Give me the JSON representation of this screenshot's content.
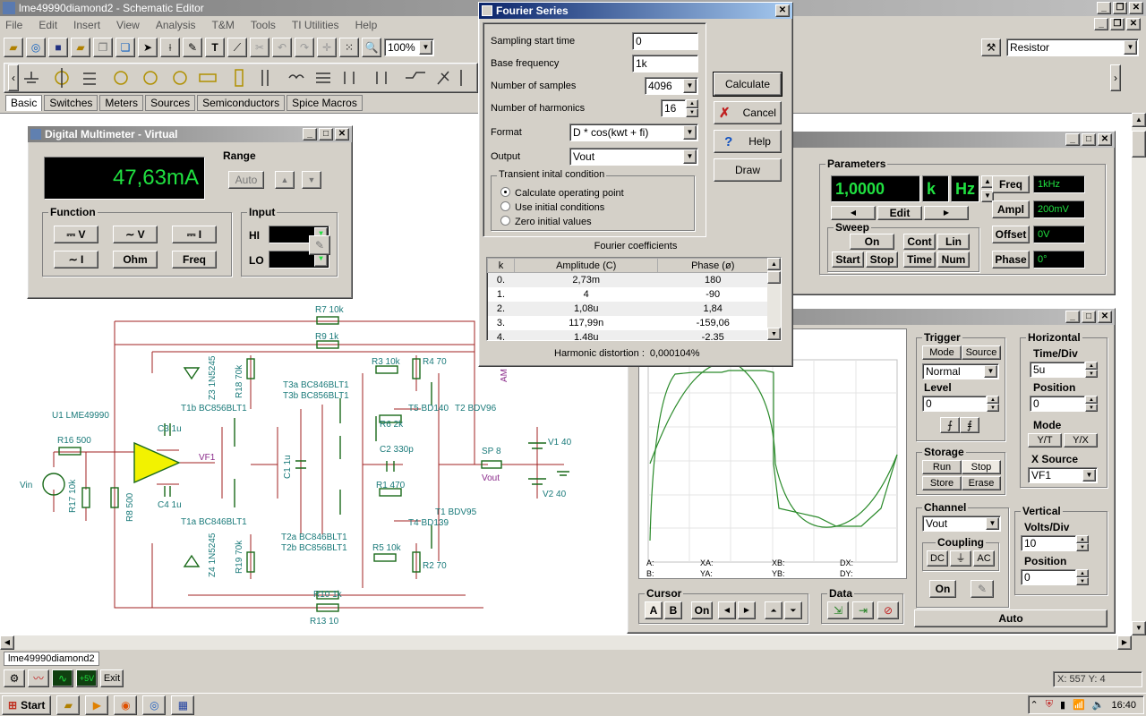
{
  "app": {
    "title": "lme49990diamond2 - Schematic Editor",
    "menu": [
      "File",
      "Edit",
      "Insert",
      "View",
      "Analysis",
      "T&M",
      "Tools",
      "TI Utilities",
      "Help"
    ],
    "zoom": "100%",
    "component_select": "Resistor",
    "tabs": [
      "Basic",
      "Switches",
      "Meters",
      "Sources",
      "Semiconductors",
      "Spice Macros"
    ],
    "doc_tab": "lme49990diamond2",
    "status_coords": "X: 557 Y: 4",
    "exit_label": "Exit"
  },
  "multimeter": {
    "title": "Digital Multimeter - Virtual",
    "display": "47,63mA",
    "range_label": "Range",
    "auto": "Auto",
    "function_label": "Function",
    "input_label": "Input",
    "buttons": [
      "⎓ V",
      "∼ V",
      "⎓ I",
      "∼ I",
      "Ohm",
      "Freq"
    ],
    "hi": "HI",
    "lo": "LO"
  },
  "fourier": {
    "title": "Fourier Series",
    "rows": [
      {
        "label": "Sampling start time",
        "value": "0"
      },
      {
        "label": "Base frequency",
        "value": "1k"
      },
      {
        "label": "Number of samples",
        "value": "4096"
      },
      {
        "label": "Number of harmonics",
        "value": "16"
      },
      {
        "label": "Format",
        "value": "D * cos(kwt + fi)"
      },
      {
        "label": "Output",
        "value": "Vout"
      }
    ],
    "transient_label": "Transient inital condition",
    "radios": [
      "Calculate operating point",
      "Use initial conditions",
      "Zero initial values"
    ],
    "buttons": {
      "calculate": "Calculate",
      "cancel": "Cancel",
      "help": "Help",
      "draw": "Draw"
    },
    "coeff_title": "Fourier coefficients",
    "headers": [
      "k",
      "Amplitude (C)",
      "Phase (ø)"
    ],
    "coeffs": [
      [
        "0.",
        "2,73m",
        "180"
      ],
      [
        "1.",
        "4",
        "-90"
      ],
      [
        "2.",
        "1,08u",
        "1,84"
      ],
      [
        "3.",
        "117,99n",
        "-159,06"
      ],
      [
        "4.",
        "1.48u",
        "-2.35"
      ]
    ],
    "thd_label": "Harmonic distortion :",
    "thd_value": "0,000104%"
  },
  "generator": {
    "params_label": "Parameters",
    "value": "1,0000",
    "prefix": "k",
    "unit": "Hz",
    "edit": "Edit",
    "sweep_label": "Sweep",
    "sweep_buttons": [
      "On",
      "Cont",
      "Lin",
      "Start",
      "Stop",
      "Time",
      "Num"
    ],
    "fields": [
      {
        "label": "Freq",
        "value": "1kHz"
      },
      {
        "label": "Ampl",
        "value": "200mV"
      },
      {
        "label": "Offset",
        "value": "0V"
      },
      {
        "label": "Phase",
        "value": "0°"
      }
    ]
  },
  "scope": {
    "trigger_label": "Trigger",
    "mode": "Mode",
    "source": "Source",
    "trigger_mode": "Normal",
    "level_label": "Level",
    "level": "0",
    "horizontal_label": "Horizontal",
    "timediv_label": "Time/Div",
    "timediv": "5u",
    "hpos_label": "Position",
    "hpos": "0",
    "hmode_label": "Mode",
    "yt": "Y/T",
    "yx": "Y/X",
    "xsource_label": "X Source",
    "xsource": "VF1",
    "storage_label": "Storage",
    "storage_buttons": [
      "Run",
      "Stop",
      "Store",
      "Erase"
    ],
    "channel_label": "Channel",
    "channel": "Vout",
    "coupling_label": "Coupling",
    "coupling": [
      "DC",
      "⏚",
      "AC"
    ],
    "ch_on": "On",
    "vertical_label": "Vertical",
    "voltsdiv_label": "Volts/Div",
    "voltsdiv": "10",
    "vpos_label": "Position",
    "vpos": "0",
    "cursor_label": "Cursor",
    "cursor_buttons": [
      "A",
      "B",
      "On"
    ],
    "data_label": "Data",
    "auto": "Auto",
    "readouts": [
      "A:",
      "XA:",
      "XB:",
      "DX:",
      "B:",
      "YA:",
      "YB:",
      "DY:"
    ]
  },
  "schematic": {
    "labels": [
      "R7 10k",
      "R9 1k",
      "R3 10k",
      "R4 70",
      "R18 70k",
      "Z3 1N5245",
      "T3a BC846BLT1",
      "T3b BC856BLT1",
      "T1b BC856BLT1",
      "T5 BD140",
      "T2 BDV96",
      "U1 LME49990",
      "C3 1u",
      "R16 500",
      "VF1",
      "R6 2k",
      "C2 330p",
      "V1 40",
      "SP 8",
      "Vout",
      "Vin",
      "R17 10k",
      "R8 500",
      "C1 1u",
      "R1 470",
      "T1 BDV95",
      "T4 BD139",
      "C4 1u",
      "T1a BC846BLT1",
      "T2a BC846BLT1",
      "T2b BC856BLT1",
      "V2 40",
      "R5 10k",
      "R2 70",
      "Z4 1N5245",
      "R19 70k",
      "R10 1k",
      "R13 10",
      "AM"
    ]
  },
  "taskbar": {
    "start": "Start",
    "clock": "16:40"
  }
}
